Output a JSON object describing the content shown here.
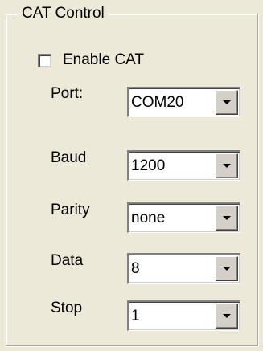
{
  "group": {
    "title": "CAT Control"
  },
  "enable_cat": {
    "label": "Enable CAT",
    "checked": false
  },
  "fields": {
    "port": {
      "label": "Port:",
      "value": "COM20"
    },
    "baud": {
      "label": "Baud",
      "value": "1200"
    },
    "parity": {
      "label": "Parity",
      "value": "none"
    },
    "data": {
      "label": "Data",
      "value": "8"
    },
    "stop": {
      "label": "Stop",
      "value": "1"
    }
  },
  "icons": {
    "dropdown": "chevron-down-icon",
    "checkbox": "checkbox-unchecked"
  },
  "colors": {
    "background": "#ece9d8",
    "field": "#ffffff",
    "button_face": "#d4d0c8"
  }
}
